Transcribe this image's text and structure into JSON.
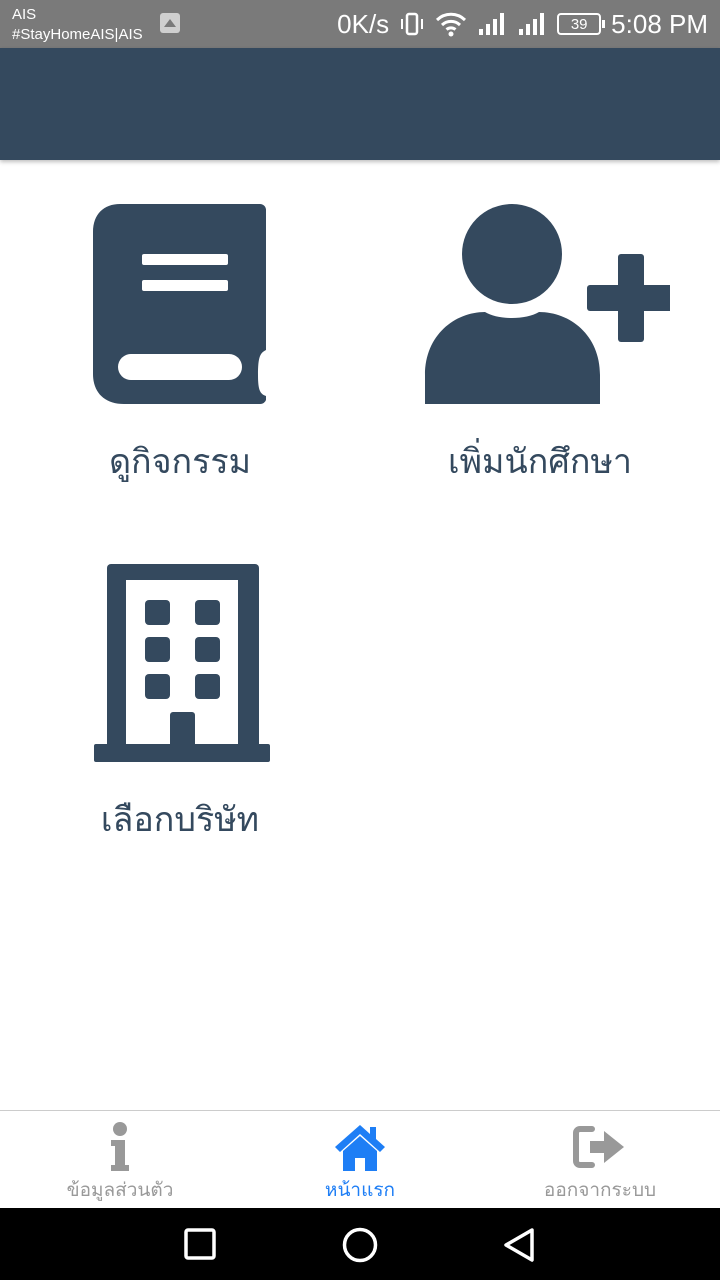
{
  "status_bar": {
    "carrier": "AIS",
    "network_name": "#StayHomeAIS|AIS",
    "speed": "0K/s",
    "battery": "39",
    "time": "5:08 PM",
    "icons": [
      "image-notification-icon",
      "vibrate-icon",
      "wifi-icon",
      "signal-icon",
      "signal-icon",
      "battery-icon"
    ]
  },
  "header": {
    "color": "#34495e"
  },
  "menu": {
    "tiles": [
      {
        "label": "ดูกิจกรรม",
        "icon": "book-icon"
      },
      {
        "label": "เพิ่มนักศึกษา",
        "icon": "user-plus-icon"
      },
      {
        "label": "เลือกบริษัท",
        "icon": "building-icon"
      }
    ],
    "icon_color": "#34495e"
  },
  "bottom_nav": {
    "items": [
      {
        "label": "ข้อมูลส่วนตัว",
        "icon": "info-icon",
        "active": false
      },
      {
        "label": "หน้าแรก",
        "icon": "home-icon",
        "active": true
      },
      {
        "label": "ออกจากระบบ",
        "icon": "sign-out-icon",
        "active": false
      }
    ],
    "active_color": "#1e7ef5",
    "inactive_color": "#999999"
  },
  "system_nav": {
    "buttons": [
      "recents-button",
      "home-button",
      "back-button"
    ]
  }
}
